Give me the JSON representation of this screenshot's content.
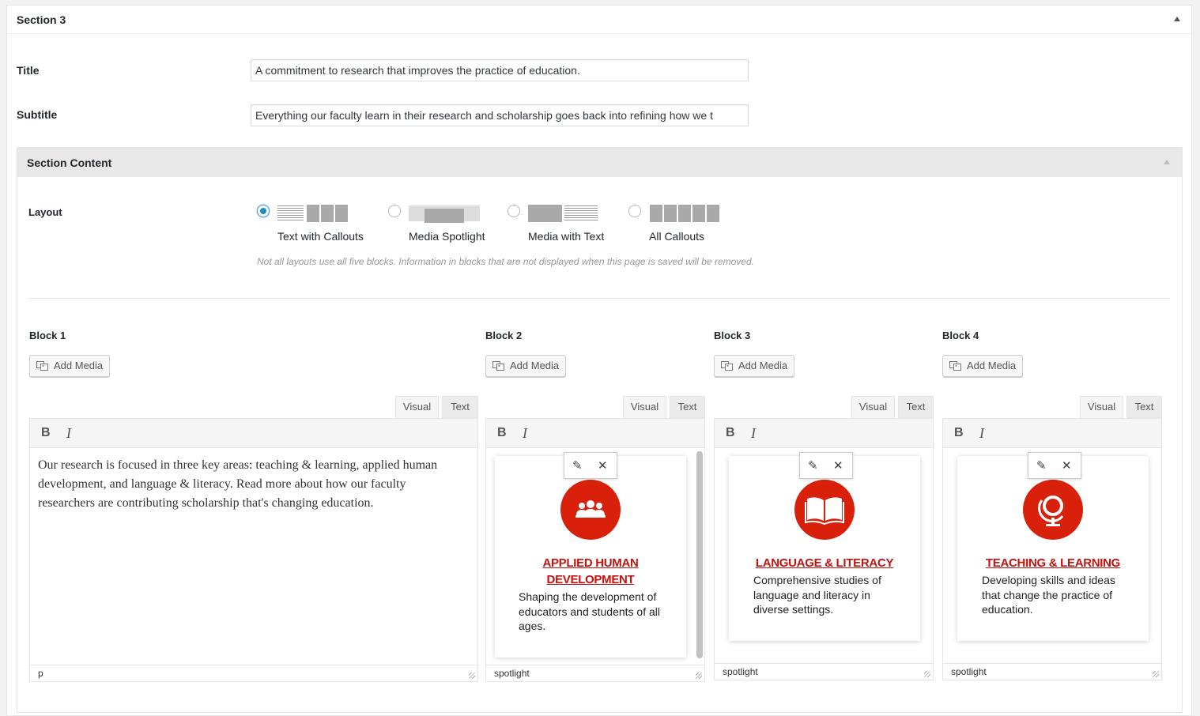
{
  "section": {
    "title": "Section 3"
  },
  "fields": {
    "title_label": "Title",
    "title_value": "A commitment to research that improves the practice of education.",
    "subtitle_label": "Subtitle",
    "subtitle_value": "Everything our faculty learn in their research and scholarship goes back into refining how we t"
  },
  "section_content": {
    "title": "Section Content",
    "layout_label": "Layout",
    "layouts": [
      {
        "label": "Text with Callouts",
        "selected": true
      },
      {
        "label": "Media Spotlight",
        "selected": false
      },
      {
        "label": "Media with Text",
        "selected": false
      },
      {
        "label": "All Callouts",
        "selected": false
      }
    ],
    "hint": "Not all layouts use all five blocks. Information in blocks that are not displayed when this page is saved will be removed."
  },
  "blocks": [
    {
      "label": "Block 1",
      "add_media": "Add Media",
      "tab_visual": "Visual",
      "tab_text": "Text",
      "body": "Our research is focused in three key areas: teaching & learning, applied human development, and language & literacy. Read more about how our faculty researchers are contributing scholarship that's changing education.",
      "status": "p"
    },
    {
      "label": "Block 2",
      "add_media": "Add Media",
      "tab_visual": "Visual",
      "tab_text": "Text",
      "card_title": "APPLIED HUMAN DEVELOPMENT",
      "card_title_line1": "APPLIED HUMAN",
      "card_title_line2": "DEVELOPMENT",
      "card_desc": "Shaping the development of educators and students of all ages.",
      "card_icon": "people-group-icon",
      "status": "spotlight"
    },
    {
      "label": "Block 3",
      "add_media": "Add Media",
      "tab_visual": "Visual",
      "tab_text": "Text",
      "card_title": "LANGUAGE & LITERACY",
      "card_desc": "Comprehensive studies of language and literacy in diverse settings.",
      "card_icon": "open-book-icon",
      "status": "spotlight"
    },
    {
      "label": "Block 4",
      "add_media": "Add Media",
      "tab_visual": "Visual",
      "tab_text": "Text",
      "card_title": "TEACHING & LEARNING",
      "card_desc": "Developing skills and ideas that change the practice of education.",
      "card_icon": "globe-icon",
      "status": "spotlight"
    }
  ],
  "toolbar": {
    "bold": "B",
    "italic": "I"
  },
  "colors": {
    "accent": "#d9200b",
    "link_red": "#c4120f",
    "radio_blue": "#1e8cbe"
  }
}
